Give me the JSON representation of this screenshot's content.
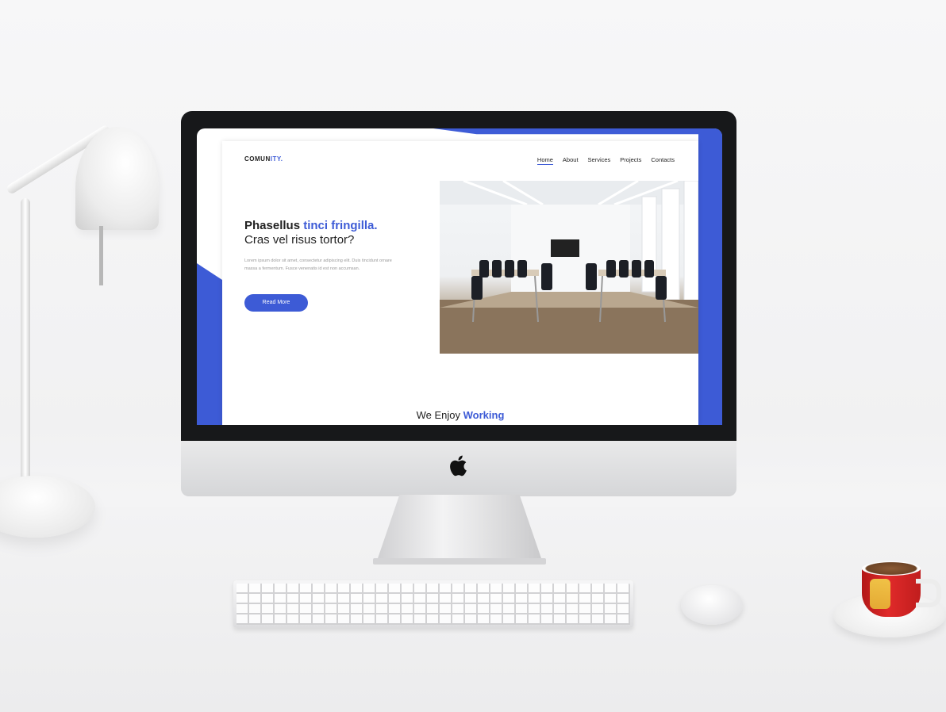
{
  "site": {
    "logo_main": "COMUN",
    "logo_accent": "ITY.",
    "nav": [
      {
        "label": "Home",
        "active": true
      },
      {
        "label": "About",
        "active": false
      },
      {
        "label": "Services",
        "active": false
      },
      {
        "label": "Projects",
        "active": false
      },
      {
        "label": "Contacts",
        "active": false
      }
    ],
    "hero": {
      "title_part1": "Phasellus ",
      "title_accent": "tinci fringilla.",
      "title_line2": "Cras vel risus tortor?",
      "body": "Lorem ipsum dolor sit amet, consectetur adipiscing elit. Duis tincidunt ornare massa a fermentum. Fusce venenatis id est non accumsan.",
      "button_label": "Read More"
    },
    "section": {
      "title_part1": "We Enjoy ",
      "title_accent": "Working"
    }
  },
  "colors": {
    "accent": "#3d5bd6",
    "text": "#222222",
    "muted": "#9a9a9a"
  },
  "icons": {
    "brand": "apple-icon"
  }
}
